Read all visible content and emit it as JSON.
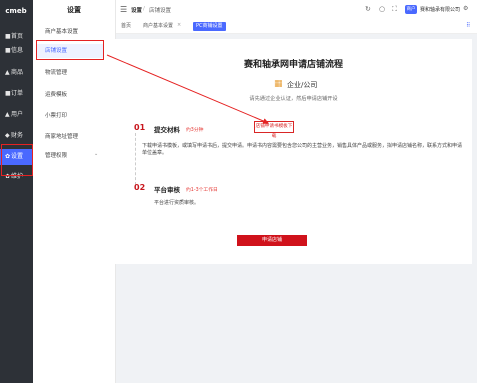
{
  "sidebar": {
    "logo": "cmeb",
    "items": [
      {
        "icon": "■",
        "label": "首页"
      },
      {
        "icon": "■",
        "label": "信息"
      },
      {
        "icon": "▲",
        "label": "商品"
      },
      {
        "icon": "■",
        "label": "订单"
      },
      {
        "icon": "▲",
        "label": "用户"
      },
      {
        "icon": "◆",
        "label": "财务"
      },
      {
        "icon": "✿",
        "label": "设置"
      },
      {
        "icon": "✿",
        "label": "维护"
      }
    ]
  },
  "subnav": {
    "title": "设置",
    "items": [
      "商户基本设置",
      "店铺设置",
      "物流管理",
      "运费模板",
      "小票打印",
      "商家地址管理",
      "管理权限"
    ]
  },
  "header": {
    "breadcrumb_root": "设置",
    "breadcrumb_sep": "/",
    "breadcrumb_current": "店铺设置",
    "badge": "商户",
    "company": "赛和轴承有限公司"
  },
  "tabs": [
    "首页",
    "商户基本设置",
    "PC商铺设置"
  ],
  "main": {
    "title": "赛和轴承网申请店铺流程",
    "entity": "企业/公司",
    "subtitle": "请先通过企业认证，然后申请店铺开设",
    "steps": [
      {
        "num": "01",
        "title": "提交材料",
        "hint": "约3分钟",
        "button": "店铺申请书模板下载",
        "desc": "下载申请书模板，或填写申请书后，提交申请。申请书内容需要包含您公司的主营业务，销售具体产品或服务，拟申请店铺名称，联系方式和申请单位盖章。"
      },
      {
        "num": "02",
        "title": "平台审核",
        "hint": "约1-3个工作日",
        "desc": "平台进行资质审核。"
      }
    ],
    "apply_button": "申请店铺"
  }
}
